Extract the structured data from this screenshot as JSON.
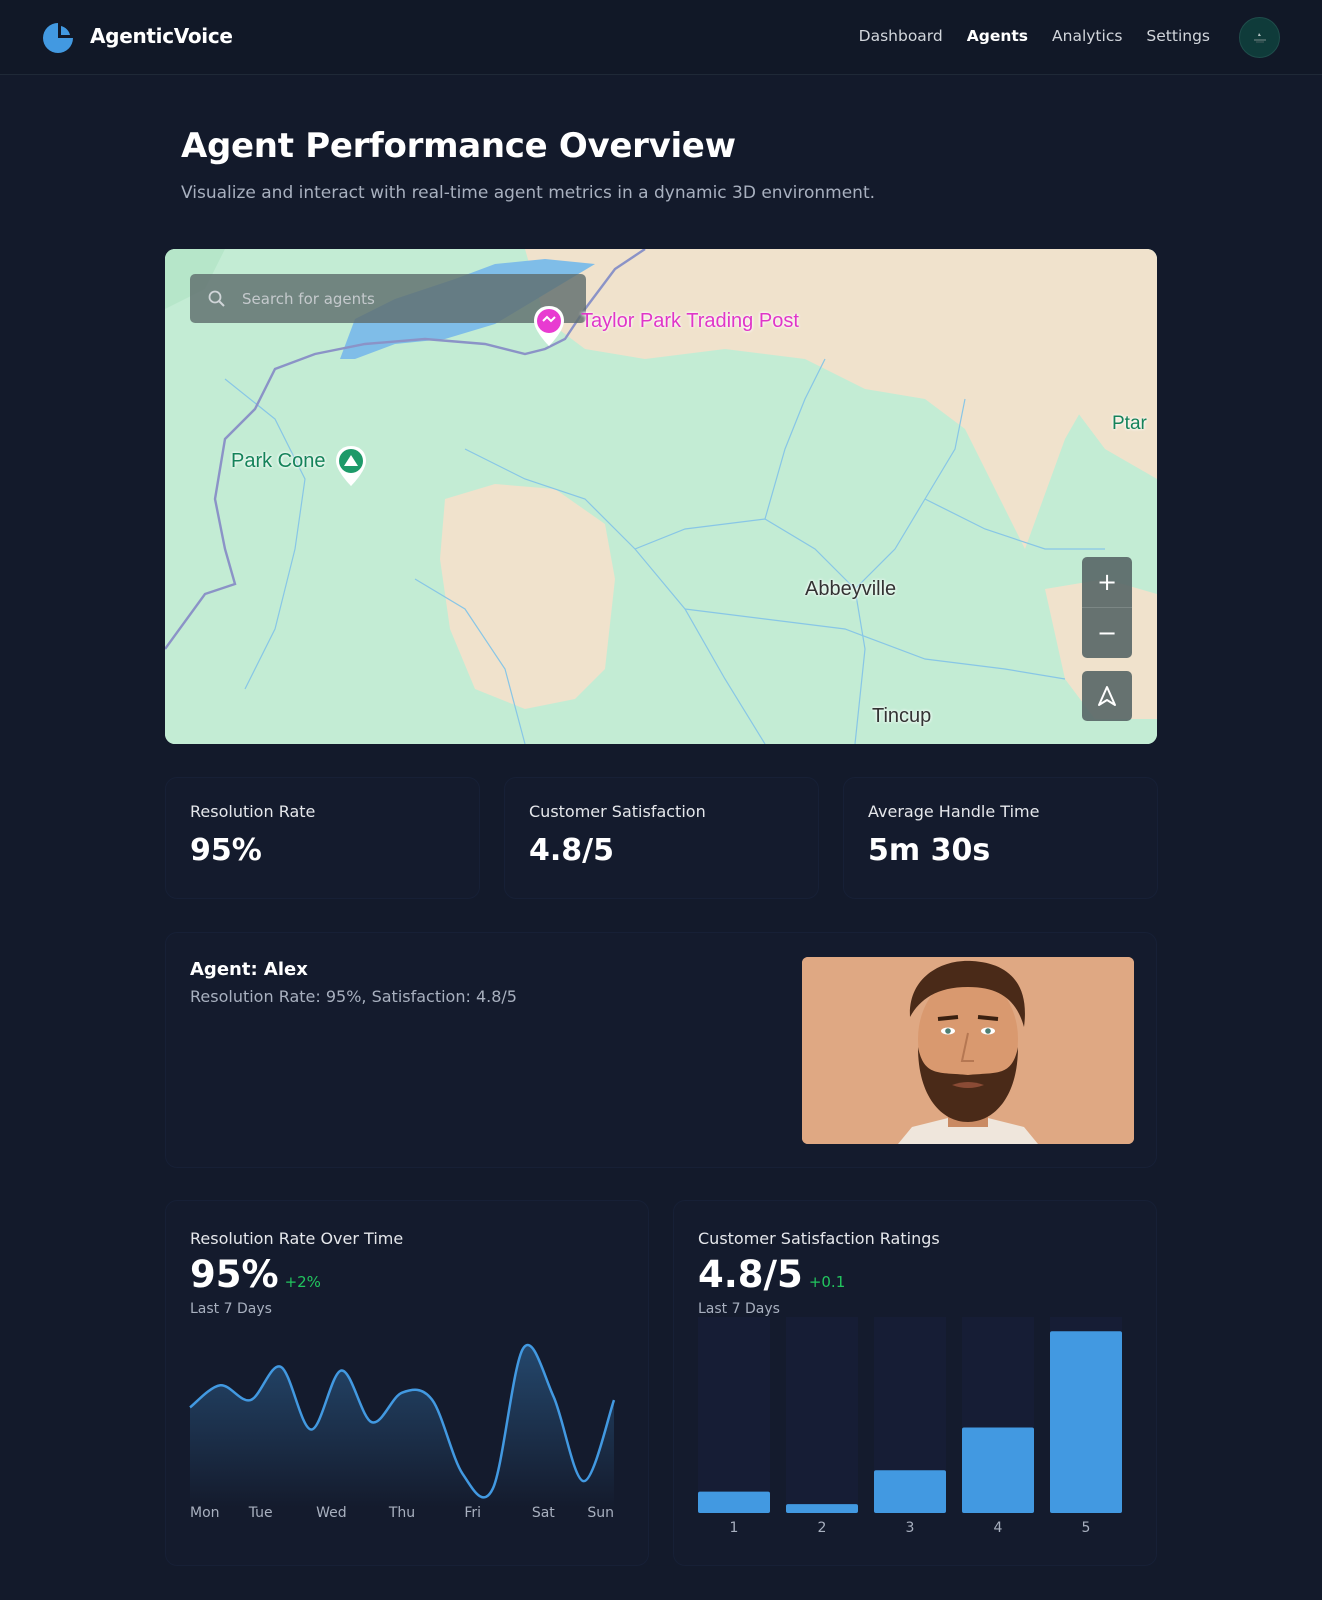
{
  "app": {
    "brand": "AgenticVoice",
    "nav": [
      "Dashboard",
      "Agents",
      "Analytics",
      "Settings"
    ],
    "active_nav": "Agents"
  },
  "page": {
    "title": "Agent Performance Overview",
    "subtitle": "Visualize and interact with real-time agent metrics in a dynamic 3D environment."
  },
  "map": {
    "search_placeholder": "Search for agents",
    "labels": {
      "poi": "Taylor Park Trading Post",
      "peak": "Park Cone",
      "town": "Abbeyville",
      "town2": "Tincup",
      "edge": "Ptar"
    },
    "zoom_in": "+",
    "zoom_out": "−"
  },
  "metrics": [
    {
      "label": "Resolution Rate",
      "value": "95%"
    },
    {
      "label": "Customer Satisfaction",
      "value": "4.8/5"
    },
    {
      "label": "Average Handle Time",
      "value": "5m 30s"
    }
  ],
  "agent": {
    "name": "Agent: Alex",
    "stats": "Resolution Rate: 95%, Satisfaction: 4.8/5"
  },
  "charts": {
    "resolution": {
      "title": "Resolution Rate Over Time",
      "value": "95%",
      "delta": "+2%",
      "period": "Last 7 Days"
    },
    "satisfaction": {
      "title": "Customer Satisfaction Ratings",
      "value": "4.8/5",
      "delta": "+0.1",
      "period": "Last 7 Days"
    }
  },
  "colors": {
    "accent": "#4299e1",
    "positive": "#22c55e",
    "background": "#131a2b",
    "card": "#141b2d"
  },
  "chart_data": [
    {
      "type": "area",
      "categories": [
        "Mon",
        "Tue",
        "Wed",
        "Thu",
        "Fri",
        "Sat",
        "Sun"
      ],
      "series": [
        {
          "values": [
            82,
            88,
            84,
            93,
            76,
            92,
            78,
            86,
            84,
            64,
            60,
            98,
            85,
            62,
            84
          ]
        }
      ],
      "ylim": [
        55,
        100
      ],
      "grid": false
    },
    {
      "type": "bar",
      "categories": [
        "1",
        "2",
        "3",
        "4",
        "5"
      ],
      "values": [
        12,
        5,
        24,
        48,
        102
      ],
      "ylim": [
        0,
        110
      ],
      "grid": false
    }
  ]
}
